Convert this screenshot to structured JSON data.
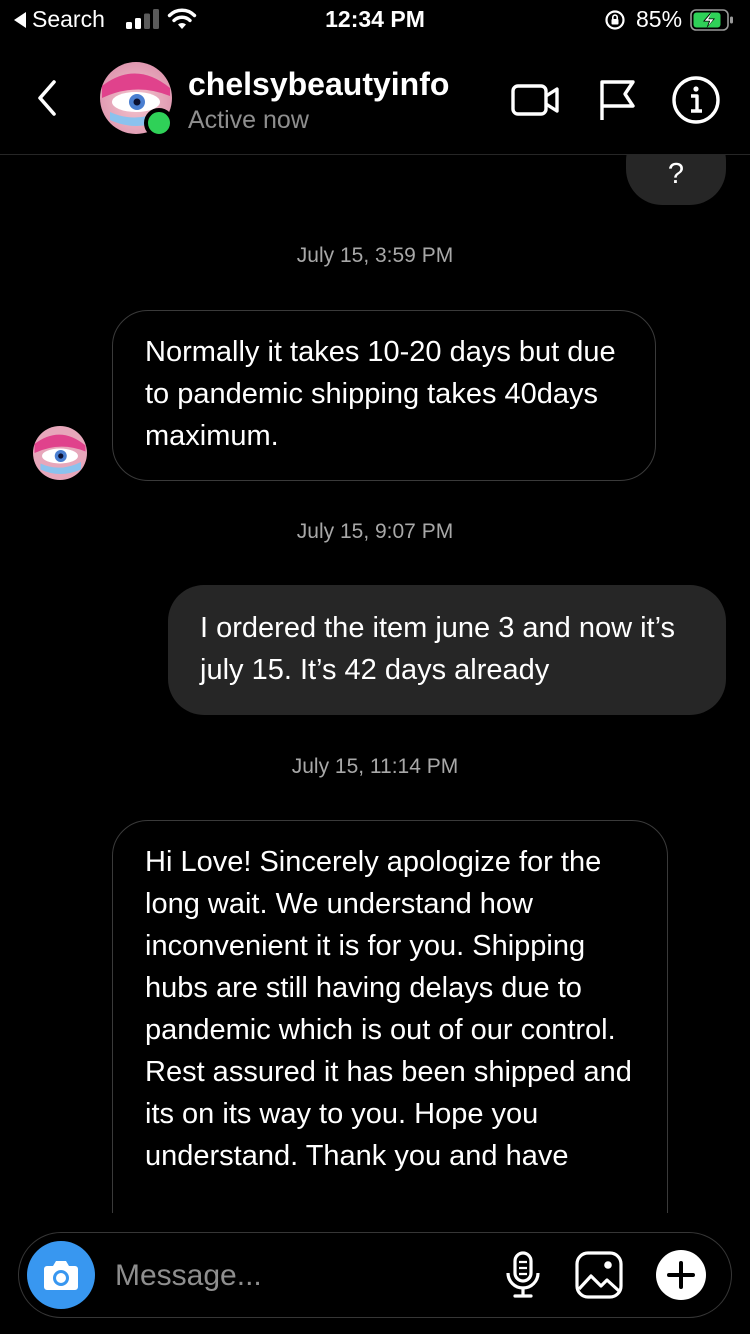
{
  "status_bar": {
    "back_app": "Search",
    "time": "12:34 PM",
    "battery_pct": "85%"
  },
  "header": {
    "username": "chelsybeautyinfo",
    "status": "Active now",
    "icons": [
      "back-chevron-icon",
      "video-call-icon",
      "flag-icon",
      "info-icon"
    ]
  },
  "messages": {
    "prev_out_text": "?",
    "ts1": "July 15, 3:59 PM",
    "in1": "Normally it takes 10-20 days but due to pandemic shipping takes 40days maximum.",
    "ts2": "July 15, 9:07 PM",
    "out1": "I ordered the item june 3 and now it’s july 15. It’s 42 days already",
    "ts3": "July 15, 11:14 PM",
    "in2": "Hi Love! Sincerely apologize for the long wait. We understand how inconvenient it  is for you. Shipping hubs are still having delays due to pandemic which is out of our control. Rest assured it has been shipped and its on its way to you. Hope you understand. Thank you and have"
  },
  "composer": {
    "placeholder": "Message...",
    "icons": [
      "camera-icon",
      "microphone-icon",
      "gallery-icon",
      "plus-icon"
    ]
  },
  "colors": {
    "background": "#000000",
    "incoming_border": "#3a3a3a",
    "outgoing_bubble": "#262626",
    "camera_button": "#3897f0",
    "online": "#2fd158"
  }
}
